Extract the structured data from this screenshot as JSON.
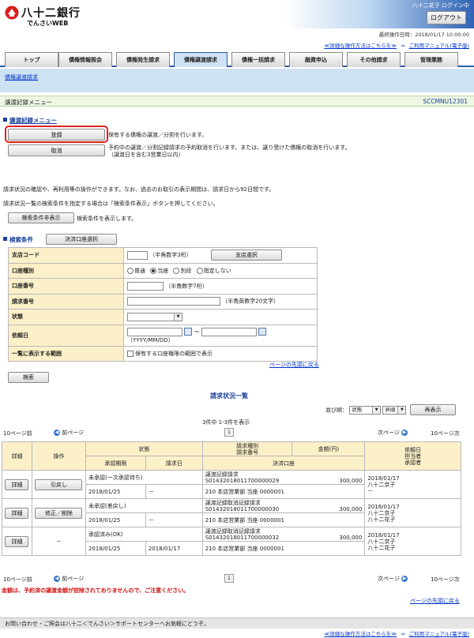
{
  "header": {
    "brand": "八十二銀行",
    "brand_sub": "でんさいWEB",
    "user": "八十二花子 ログイン中",
    "logout": "ログアウト",
    "last_op": "最終操作日時：2018/01/17 10:00:00"
  },
  "help": {
    "details": "≪詳細な操作方法はこちらを≫",
    "arrow": "⇒",
    "manual": "ご利用マニュアル(電子版)"
  },
  "tabs": [
    "トップ",
    "債権情報照会",
    "債権発生請求",
    "債権譲渡請求",
    "債権一括請求",
    "融資申込",
    "その他請求",
    "管理業務"
  ],
  "active_tab": 3,
  "subnav": {
    "label": "債権譲渡請求"
  },
  "titlebar": {
    "title": "譲渡記録メニュー",
    "code": "SCCMNU12301"
  },
  "menu": {
    "section_title": "譲渡記録メニュー",
    "register_label": "登録",
    "register_desc": "保有する債権の譲渡／分割を行います。",
    "cancel_label": "取消",
    "cancel_desc_1": "予約中の譲渡／分割記録請求の予約取消を行います。または、譲り受けた債権の取消を行います。",
    "cancel_desc_2": "（譲渡日を含む3営業日以内）"
  },
  "info": {
    "line1": "請求状況の確認や、再利用等の操作ができます。なお、過去のお取引の表示期間は、請求日から92日間です。",
    "line2": "請求状況一覧の検索条件を指定する場合は「検索条件表示」ボタンを押してください。",
    "toggle_label": "検索条件非表示",
    "toggle_desc": "検索条件を表示します。"
  },
  "search": {
    "section_title": "検索条件",
    "acct_select_btn": "決済口座選択",
    "branch_label": "支店コード",
    "branch_hint": "（半角数字3桁）",
    "branch_btn": "支店選択",
    "acct_type_label": "口座種別",
    "acct_types": [
      "普通",
      "当座",
      "別段",
      "指定しない"
    ],
    "acct_no_label": "口座番号",
    "acct_no_hint": "（半角数字7桁）",
    "req_no_label": "請求番号",
    "req_no_hint": "（半角英数字20文字）",
    "status_label": "状態",
    "date_label": "依頼日",
    "date_hint": "（YYYY/MM/DD）",
    "tilde": "～",
    "scope_label": "一覧に表示する範囲",
    "scope_desc": "保有する口座権限の範囲で表示",
    "top_link": "ページの先頭に戻る",
    "search_btn": "検索"
  },
  "results": {
    "title": "請求状況一覧",
    "sort_label": "並び順：",
    "sort_value": "状態",
    "order_value": "昇順",
    "redisplay_btn": "再表示",
    "count_text": "3件中 1-3件を表示",
    "prev10": "10ページ前",
    "prev": "前ページ",
    "page": "1",
    "next": "次ページ",
    "next10": "10ページ次",
    "headers": {
      "detail": "詳細",
      "ops": "操作",
      "status": "状態",
      "approval_deadline": "承認期限",
      "request_date": "請求日",
      "type": "請求種別\n請求番号",
      "amount": "金額(円)",
      "settle_acct": "決済口座",
      "requester": "依頼日\n担当者\n承認者"
    },
    "rows": [
      {
        "detail": "詳細",
        "op": "引戻し",
        "status": "未承認(一次承認待ち)",
        "deadline": "2018/01/25",
        "req_date": "－",
        "type": "譲渡記録請求",
        "number": "S01432018011700000029",
        "amount": "300,000",
        "account": "210 本店営業部 当座 0000001",
        "date": "2018/01/17",
        "user1": "八十二京子",
        "user2": "－"
      },
      {
        "detail": "詳細",
        "op": "修正／削除",
        "status": "未承認(差戻し)",
        "deadline": "2018/01/25",
        "req_date": "－",
        "type": "譲渡記録取消記録請求",
        "number": "S01432018011700000030",
        "amount": "300,000",
        "account": "210 本店営業部 当座 0000001",
        "date": "2018/01/17",
        "user1": "八十二京子",
        "user2": "八十二花子"
      },
      {
        "detail": "詳細",
        "op": "－",
        "status": "承認済み(OK)",
        "deadline": "2018/01/25",
        "req_date": "2018/01/17",
        "type": "譲渡記録取消記録請求",
        "number": "S01432018011700000032",
        "amount": "300,000",
        "account": "210 本店営業部 当座 0000001",
        "date": "2018/01/17",
        "user1": "八十二京子",
        "user2": "八十二花子"
      }
    ],
    "warning": "金額は、予約済の譲渡金額が控除されておりませんので、ご注意ください。",
    "top_link": "ページの先頭に戻る"
  },
  "footer": {
    "text": "お問い合わせ・ご照会は八十二＜でんさい＞サポートセンターへお気軽にどうぞ。"
  },
  "colors": {
    "accent": "#2c5bad",
    "label_bg": "#fbf0c8",
    "highlight": "#e02020",
    "warning": "#d01010"
  }
}
